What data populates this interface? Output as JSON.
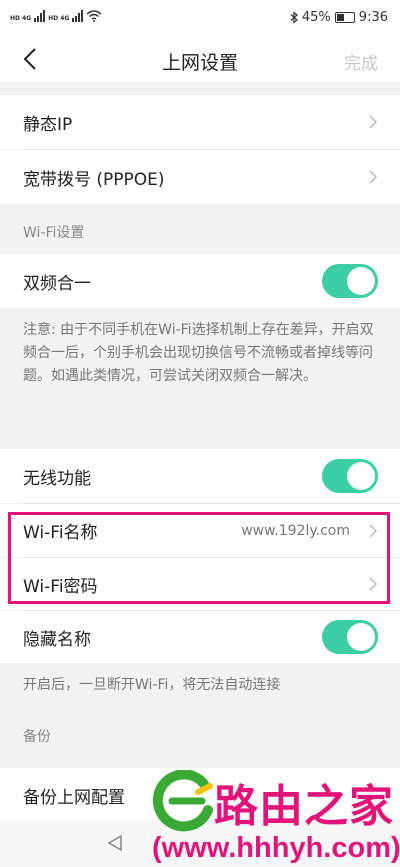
{
  "status": {
    "sim1": "HD 4G",
    "sim2": "HD 4G",
    "battery": "45%",
    "time": "9:36"
  },
  "nav": {
    "title": "上网设置",
    "done": "完成"
  },
  "rows": {
    "static_ip": "静态IP",
    "pppoe": "宽带拨号 (PPPOE)"
  },
  "wifi_section": {
    "header": "Wi-Fi设置",
    "dual_band": "双频合一",
    "dual_band_on": true,
    "note": "注意: 由于不同手机在Wi-Fi选择机制上存在差异，开启双频合一后，个别手机会出现切换信号不流畅或者掉线等问题。如遇此类情况，可尝试关闭双频合一解决。",
    "wireless": "无线功能",
    "wireless_on": true,
    "ssid_label": "Wi-Fi名称",
    "ssid_value": "www.192ly.com",
    "password_label": "Wi-Fi密码",
    "hide_name": "隐藏名称",
    "hide_name_on": true,
    "hide_note": "开启后，一旦断开Wi-Fi，将无法自动连接"
  },
  "backup_section": {
    "header": "备份",
    "backup_config": "备份上网配置"
  },
  "watermark": {
    "brand": "路由之家",
    "url": "(www.hhhyh.com)"
  },
  "colors": {
    "accent": "#3ccfa3",
    "highlight": "#e3127d"
  }
}
